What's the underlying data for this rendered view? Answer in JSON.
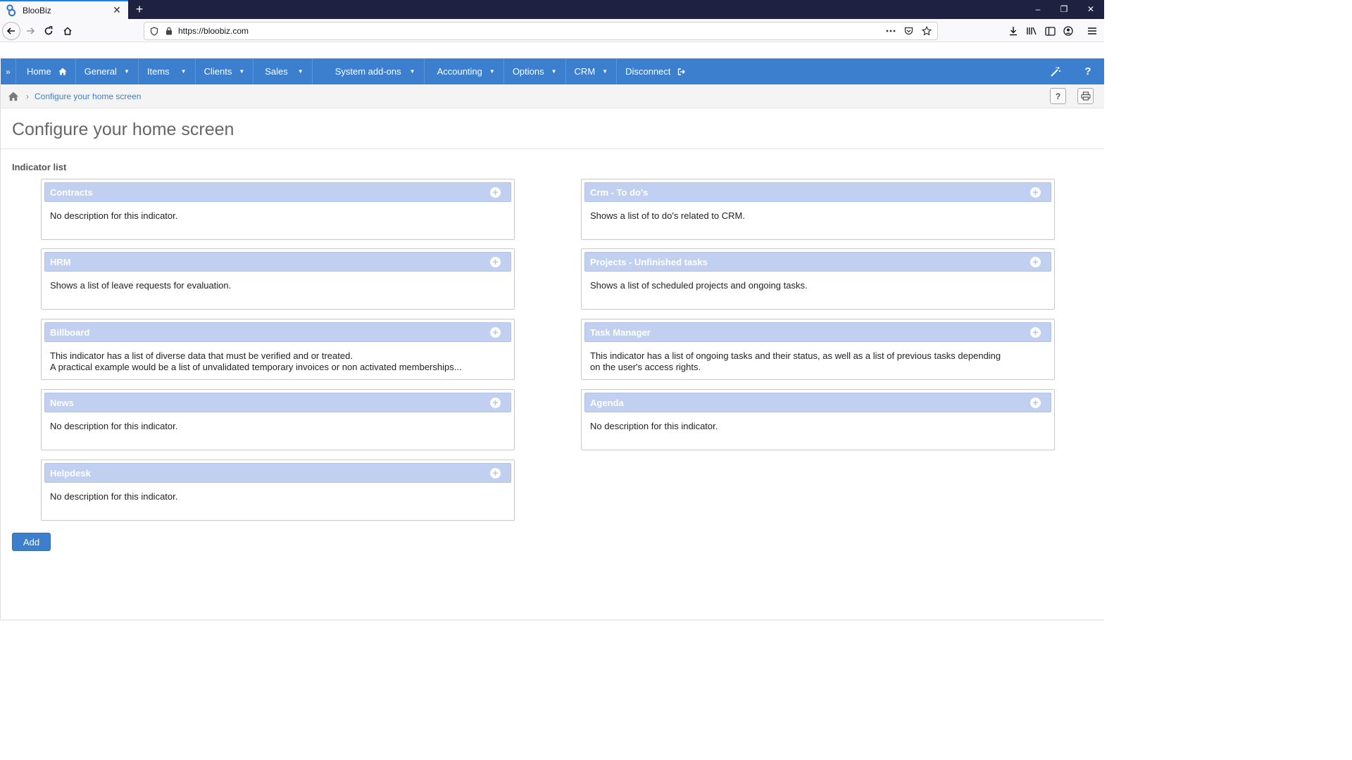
{
  "browser": {
    "tab_title": "BlooBiz",
    "url": "https://bloobiz.com",
    "new_tab": "+",
    "tab_close": "✕",
    "window_controls": [
      "–",
      "❐",
      "✕"
    ]
  },
  "menu": {
    "toggle": "»",
    "items": [
      {
        "label": "Home",
        "icon": "home-icon"
      },
      {
        "label": "General",
        "caret": true
      },
      {
        "label": "Items",
        "caret": true
      },
      {
        "label": "Clients",
        "caret": true
      },
      {
        "label": "Sales",
        "caret": true
      },
      {
        "label": "System add-ons",
        "caret": true
      },
      {
        "label": "Accounting",
        "caret": true
      },
      {
        "label": "Options",
        "caret": true
      },
      {
        "label": "CRM",
        "caret": true
      },
      {
        "label": "Disconnect",
        "icon": "logout-icon"
      }
    ],
    "help": "?"
  },
  "breadcrumb": {
    "current": "Configure your home screen",
    "separator": "›",
    "help_button": "?"
  },
  "page": {
    "title": "Configure your home screen",
    "section_label": "Indicator list",
    "add_button": "Add"
  },
  "indicators_left": [
    {
      "title": "Contracts",
      "description": "No description for this indicator."
    },
    {
      "title": "HRM",
      "description": "Shows a list of leave requests for evaluation."
    },
    {
      "title": "Billboard",
      "description": "This indicator has a list of diverse data that must be verified and or treated.\nA practical example would be a list of unvalidated temporary invoices or non activated memberships..."
    },
    {
      "title": "News",
      "description": "No description for this indicator."
    },
    {
      "title": "Helpdesk",
      "description": "No description for this indicator."
    }
  ],
  "indicators_right": [
    {
      "title": "Crm - To do's",
      "description": "Shows a list of to do's related to CRM."
    },
    {
      "title": "Projects - Unfinished tasks",
      "description": "Shows a list of scheduled projects and ongoing tasks."
    },
    {
      "title": "Task Manager",
      "description": "This indicator has a list of ongoing tasks and their status, as well as a list of previous tasks depending on the user's access rights."
    },
    {
      "title": "Agenda",
      "description": "No description for this indicator."
    }
  ],
  "colors": {
    "menu_bar": "#3d7fcf",
    "card_header": "#c1cff0",
    "tab_accent": "#0a84ff"
  }
}
